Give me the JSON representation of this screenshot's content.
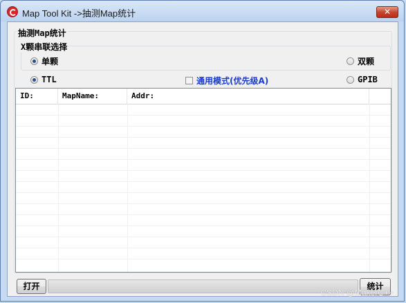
{
  "window": {
    "title": "Map Tool Kit ->抽测Map统计",
    "close_label": "✕"
  },
  "groups": {
    "outer_label": "抽测Map统计",
    "inner_label": "X颗串联选择"
  },
  "options": {
    "single": "单颗",
    "double": "双颗",
    "ttl": "TTL",
    "gpib": "GPIB",
    "general_mode": "通用模式(优先级A)"
  },
  "state": {
    "single_selected": true,
    "double_selected": false,
    "ttl_selected": true,
    "gpib_selected": false,
    "general_mode_checked": false
  },
  "table": {
    "columns": [
      "ID:",
      "MapName:",
      "Addr:",
      ""
    ],
    "rows": []
  },
  "buttons": {
    "open": "打开",
    "stats": "统计"
  },
  "progress": {
    "value": 0
  },
  "watermark": "CSDN @MakerC++",
  "colors": {
    "accent_blue": "#1a3bd6",
    "close_red": "#c6462f"
  }
}
